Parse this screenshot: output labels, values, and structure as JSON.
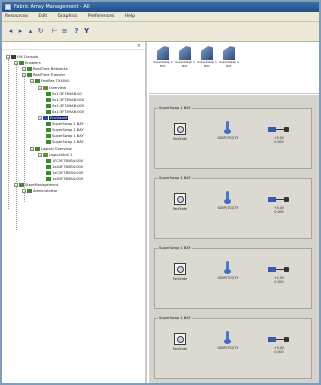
{
  "window": {
    "title": "Fabric Array Management - All"
  },
  "menubar": {
    "items": [
      "Resources",
      "Edit",
      "Graphics",
      "Preferences",
      "Help"
    ]
  },
  "toolbar": {
    "buttons": [
      {
        "name": "back",
        "icon": "arrow-left-icon"
      },
      {
        "name": "forward",
        "icon": "arrow-right-icon"
      },
      {
        "name": "up",
        "icon": "arrow-up-icon"
      },
      {
        "name": "refresh",
        "icon": "refresh-icon"
      },
      {
        "name": "tree-view",
        "icon": "tree-icon"
      },
      {
        "name": "list-view",
        "icon": "list-icon"
      },
      {
        "name": "help",
        "icon": "question-icon"
      },
      {
        "name": "filter",
        "icon": "filter-icon"
      }
    ]
  },
  "tree": {
    "nodes": [
      {
        "label": "Hill Console",
        "level": 0
      },
      {
        "label": "Enablers",
        "level": 1
      },
      {
        "label": "RealTime Networks",
        "level": 2
      },
      {
        "label": "RealTime Transfer",
        "level": 2
      },
      {
        "label": "FastRes TX4000",
        "level": 3
      },
      {
        "label": "Overview",
        "level": 4
      },
      {
        "label": "0x1:3F789AB:00",
        "level": 5
      },
      {
        "label": "0x1:3F789AB:000",
        "level": 5
      },
      {
        "label": "0x1:3F789AB:000",
        "level": 5
      },
      {
        "label": "0x1:3F789AB:000",
        "level": 5
      },
      {
        "label": "Enclosure",
        "level": 4,
        "selected": true
      },
      {
        "label": "SuperSwap 1 BAY",
        "level": 5
      },
      {
        "label": "SuperSwap 1 BAY",
        "level": 5
      },
      {
        "label": "SuperSwap 1 BAY",
        "level": 5
      },
      {
        "label": "SuperSwap 1 BAY",
        "level": 5
      },
      {
        "label": "Logical Overview",
        "level": 3
      },
      {
        "label": "LogicalUnit 1",
        "level": 4
      },
      {
        "label": "1FC5F7B0B4:000",
        "level": 5
      },
      {
        "label": "1xA4F7B0B4:000",
        "level": 5
      },
      {
        "label": "1xC5F7B0B4:000",
        "level": 5
      },
      {
        "label": "1xA5F7B0B4:000",
        "level": 5
      },
      {
        "label": "StoreManagement",
        "level": 1
      },
      {
        "label": "Administrator",
        "level": 2
      }
    ]
  },
  "iconstrip": {
    "items": [
      {
        "label": "SuperSwap 1 BAY"
      },
      {
        "label": "SuperSwap 1 BAY"
      },
      {
        "label": "SuperSwap 1 BAY"
      },
      {
        "label": "SuperSwap 1 BAY"
      }
    ]
  },
  "panels": [
    {
      "title": "SuperSwap 1 BAY",
      "fan": "Fan0rate",
      "temp": "SDVP(TCS)TY",
      "power": "+5.0V",
      "power2": "0.000"
    },
    {
      "title": "SuperSwap 1 BAY",
      "fan": "Fan0rate",
      "temp": "SDVP(TCS)TY",
      "power": "+5.0V",
      "power2": "0.000"
    },
    {
      "title": "SuperSwap 1 BAY",
      "fan": "Fan0rate",
      "temp": "SDVP(TCS)TY",
      "power": "+5.0V",
      "power2": "0.000"
    },
    {
      "title": "SuperSwap 1 BAY",
      "fan": "Fan0rate",
      "temp": "SDVP(TCS)TY",
      "power": "+5.0V",
      "power2": "0.000"
    }
  ],
  "colors": {
    "selection": "#0a246a",
    "panel_bg": "#d6d3ce",
    "title_bar": "#1f4f8a"
  }
}
